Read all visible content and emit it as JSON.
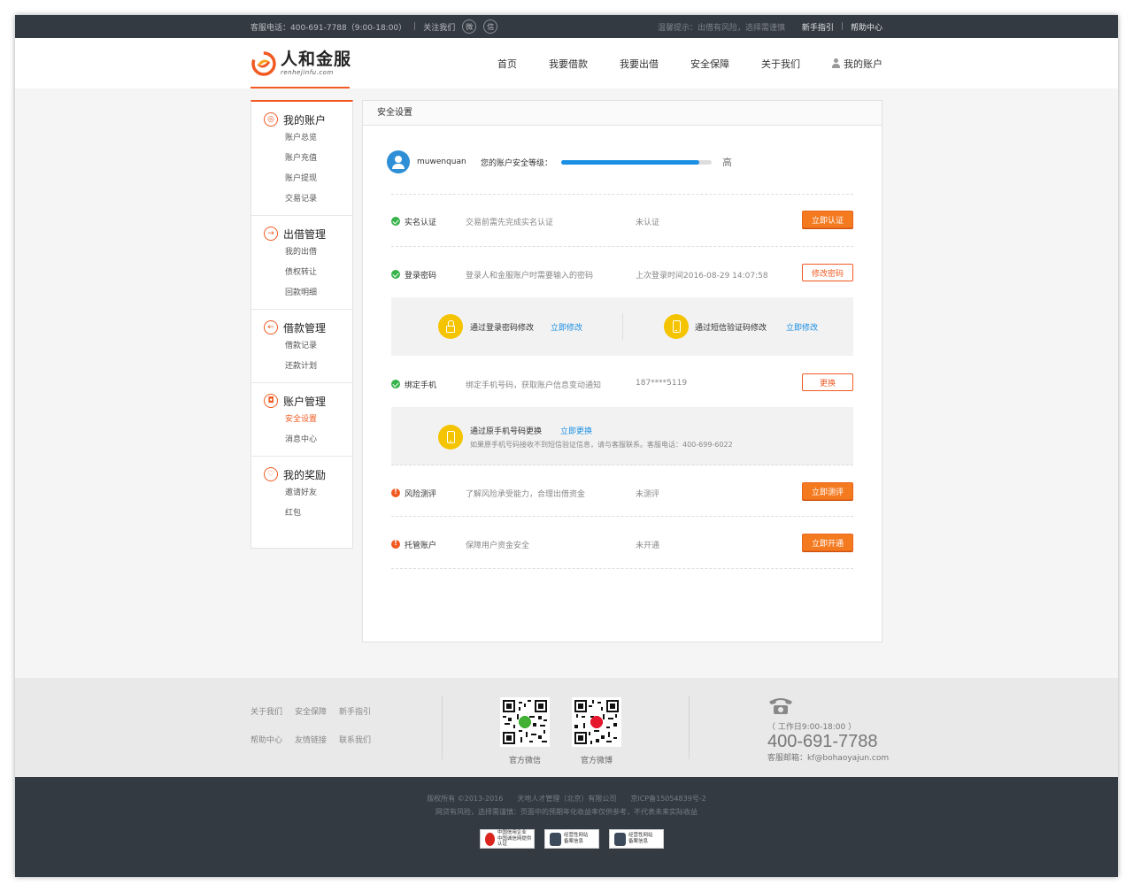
{
  "topbar": {
    "hotline": "客服电话：400-691-7788（9:00-18:00）",
    "follow": "关注我们",
    "weibo_glyph": "微",
    "wechat_glyph": "信",
    "notice": "温馨提示：出借有风险，选择需谨慎",
    "guide": "新手指引",
    "help": "帮助中心"
  },
  "brand": {
    "name": "人和金服",
    "domain": "renhejinfu.com",
    "colors": {
      "accent": "#f15a22",
      "blue": "#1a8fe3",
      "dark": "#333a42",
      "yellow": "#f5c400",
      "ok": "#37b34a"
    }
  },
  "nav": {
    "items": [
      "首页",
      "我要借款",
      "我要出借",
      "安全保障",
      "关于我们"
    ],
    "account": "我的账户"
  },
  "sidebar": {
    "groups": [
      {
        "title": "我的账户",
        "icon": "user-icon",
        "glyph": "◎",
        "items": [
          "账户总览",
          "账户充值",
          "账户提现",
          "交易记录"
        ]
      },
      {
        "title": "出借管理",
        "icon": "arrow-right-icon",
        "glyph": "→",
        "items": [
          "我的出借",
          "债权转让",
          "回款明细"
        ]
      },
      {
        "title": "借款管理",
        "icon": "arrow-left-icon",
        "glyph": "←",
        "items": [
          "借款记录",
          "还款计划"
        ]
      },
      {
        "title": "账户管理",
        "icon": "lock-icon",
        "glyph": "◘",
        "items": [
          "安全设置",
          "消息中心"
        ]
      },
      {
        "title": "我的奖励",
        "icon": "heart-icon",
        "glyph": "♡",
        "items": [
          "邀请好友",
          "红包"
        ]
      }
    ],
    "active": "安全设置"
  },
  "panel": {
    "title": "安全设置",
    "username": "muwenquan",
    "level_label": "您的账户安全等级：",
    "level_fraction": 0.92,
    "level_text": "高",
    "rows": {
      "realname": {
        "name": "实名认证",
        "desc": "交易前需先完成实名认证",
        "status": "未认证",
        "button": "立即认证",
        "state": "ok"
      },
      "password": {
        "name": "登录密码",
        "desc": "登录人和金服账户时需要输入的密码",
        "status": "上次登录时间2016-08-29 14:07:58",
        "button": "修改密码",
        "state": "ok"
      },
      "phone": {
        "name": "绑定手机",
        "desc": "绑定手机号码，获取账户信息变动通知",
        "status": "187****5119",
        "button": "更换",
        "state": "ok"
      },
      "risk": {
        "name": "风险测评",
        "desc": "了解风险承受能力，合理出借资金",
        "status": "未测评",
        "button": "立即测评",
        "state": "warn"
      },
      "custody": {
        "name": "托管账户",
        "desc": "保障用户资金安全",
        "status": "未开通",
        "button": "立即开通",
        "state": "warn"
      }
    },
    "pwd_options": {
      "by_password": "通过登录密码修改",
      "by_password_link": "立即修改",
      "by_sms": "通过短信验证码修改",
      "by_sms_link": "立即修改"
    },
    "phone_option": {
      "text": "通过原手机号码更换",
      "link": "立即更换",
      "note": "如果原手机号码接收不到短信验证信息，请与客服联系。客服电话：400-699-6022"
    }
  },
  "footer": {
    "links": [
      "关于我们",
      "安全保障",
      "新手指引",
      "帮助中心",
      "友情链接",
      "联系我们"
    ],
    "qr_wechat": "官方微信",
    "qr_weibo": "官方微博",
    "hours": "（ 工作日9:00-18:00 ）",
    "phone": "400-691-7788",
    "email": "客服邮箱：kf@bohaoyajun.com",
    "copyright": "版权所有 ©2013-2016　　天地人才管理（北京）有限公司　　京ICP备15054839号-2",
    "risk_notice": "网贷有风险，选择需谨慎：页面中的预期年化收益率仅供参考，不代表未来实际收益",
    "badges": [
      {
        "line1": "中国信用企业",
        "line2": "中国诚信网提供认证"
      },
      {
        "line1": "经营性网站",
        "line2": "备案信息"
      },
      {
        "line1": "经营性网站",
        "line2": "备案信息"
      }
    ]
  }
}
